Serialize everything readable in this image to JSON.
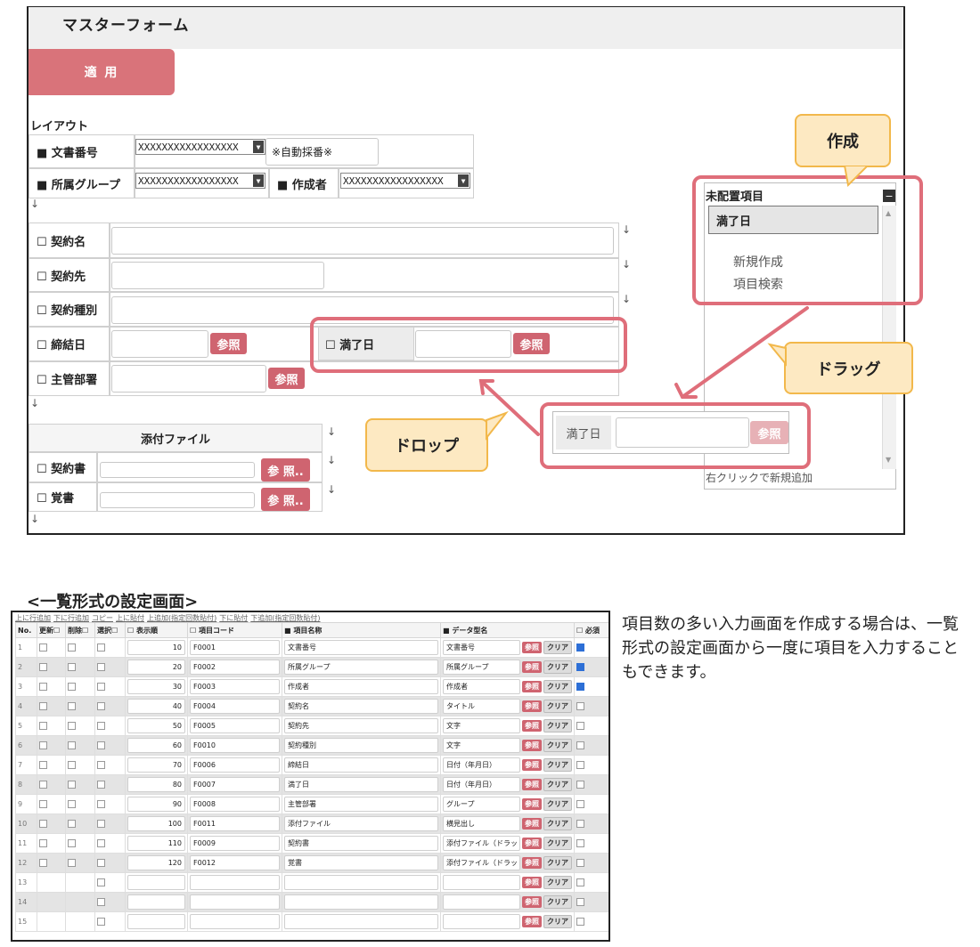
{
  "app": {
    "title": "マスターフォーム",
    "apply_label": "適 用",
    "layout_label": "レイアウト"
  },
  "form": {
    "doc_no_label": "■ 文書番号",
    "doc_no_value": "XXXXXXXXXXXXXXXXX",
    "auto_number": "※自動採番※",
    "group_label": "■ 所属グループ",
    "group_value": "XXXXXXXXXXXXXXXXX",
    "author_label": "■ 作成者",
    "author_value": "XXXXXXXXXXXXXXXXX",
    "contract_name": "☐ 契約名",
    "contract_party": "☐ 契約先",
    "contract_type": "☐ 契約種別",
    "sign_date": "☐ 締結日",
    "expiry": "☐ 満了日",
    "dept": "☐ 主管部署",
    "ref": "参照",
    "attach_title": "添付ファイル",
    "contract_doc": "☐ 契約書",
    "memo": "☐ 覚書",
    "ref2": "参 照..",
    "arrow": "↓"
  },
  "unplaced": {
    "title": "未配置項目",
    "minus": "−",
    "item": "満了日",
    "new": "新規作成",
    "search": "項目検索",
    "hint": "右クリックで新規追加"
  },
  "drag_item": {
    "label": "満了日",
    "ref": "参照"
  },
  "callouts": {
    "create": "作成",
    "drag": "ドラッグ",
    "drop": "ドロップ"
  },
  "list": {
    "title": "<一覧形式の設定画面>",
    "links": [
      "上に行追加",
      "下に行追加",
      "コピー",
      "上に貼付",
      "上追加(指定回数貼付)",
      "下に貼付",
      "下追加(指定回数貼付)"
    ],
    "headers": [
      "No.",
      "更新☐",
      "削除☐",
      "選択☐",
      "☐ 表示順",
      "☐ 項目コード",
      "■ 項目名称",
      "■ データ型名",
      "☐ 必須"
    ],
    "ref": "参照",
    "clear": "クリア",
    "rows": [
      {
        "no": "1",
        "order": "10",
        "code": "F0001",
        "name": "文書番号",
        "type": "文書番号",
        "req": true,
        "full": true
      },
      {
        "no": "2",
        "order": "20",
        "code": "F0002",
        "name": "所属グループ",
        "type": "所属グループ",
        "req": true,
        "full": true
      },
      {
        "no": "3",
        "order": "30",
        "code": "F0003",
        "name": "作成者",
        "type": "作成者",
        "req": true,
        "full": true
      },
      {
        "no": "4",
        "order": "40",
        "code": "F0004",
        "name": "契約名",
        "type": "タイトル",
        "req": false,
        "full": true
      },
      {
        "no": "5",
        "order": "50",
        "code": "F0005",
        "name": "契約先",
        "type": "文字",
        "req": false,
        "full": true
      },
      {
        "no": "6",
        "order": "60",
        "code": "F0010",
        "name": "契約種別",
        "type": "文字",
        "req": false,
        "full": true
      },
      {
        "no": "7",
        "order": "70",
        "code": "F0006",
        "name": "締結日",
        "type": "日付（年月日）",
        "req": false,
        "full": true
      },
      {
        "no": "8",
        "order": "80",
        "code": "F0007",
        "name": "満了日",
        "type": "日付（年月日）",
        "req": false,
        "full": true
      },
      {
        "no": "9",
        "order": "90",
        "code": "F0008",
        "name": "主管部署",
        "type": "グループ",
        "req": false,
        "full": true
      },
      {
        "no": "10",
        "order": "100",
        "code": "F0011",
        "name": "添付ファイル",
        "type": "横見出し",
        "req": false,
        "full": true
      },
      {
        "no": "11",
        "order": "110",
        "code": "F0009",
        "name": "契約書",
        "type": "添付ファイル（ドラッ",
        "req": false,
        "full": true
      },
      {
        "no": "12",
        "order": "120",
        "code": "F0012",
        "name": "覚書",
        "type": "添付ファイル（ドラッ",
        "req": false,
        "full": true
      },
      {
        "no": "13",
        "order": "",
        "code": "",
        "name": "",
        "type": "",
        "req": false,
        "full": false
      },
      {
        "no": "14",
        "order": "",
        "code": "",
        "name": "",
        "type": "",
        "req": false,
        "full": false
      },
      {
        "no": "15",
        "order": "",
        "code": "",
        "name": "",
        "type": "",
        "req": false,
        "full": false
      }
    ]
  },
  "description": "項目数の多い入力画面を作成する場合は、一覧形式の設定画面から一度に項目を入力することもできます。",
  "colors": {
    "accent": "#d9737a",
    "highlight_border": "#df6e7a",
    "callout_bg": "#fde9c2",
    "callout_border": "#f2b84b"
  }
}
